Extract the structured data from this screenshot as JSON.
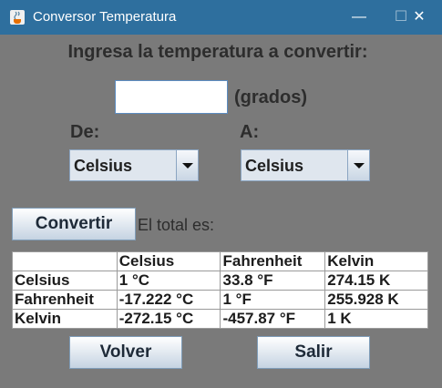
{
  "window": {
    "title": "Conversor Temperatura",
    "icon": "java-coffee-icon",
    "minimize_glyph": "—",
    "maximize_glyph": "☐",
    "close_glyph": "✕",
    "accent": "#2e6f9e",
    "background": "#7a7a7a"
  },
  "form": {
    "heading": "Ingresa la temperatura a convertir:",
    "input_value": "",
    "unit_label": "(grados)",
    "from_label": "De:",
    "to_label": "A:",
    "from_selected": "Celsius",
    "to_selected": "Celsius",
    "convert_label": "Convertir",
    "total_label": "El total es:"
  },
  "results": {
    "headers": [
      "",
      "Celsius",
      "Fahrenheit",
      "Kelvin"
    ],
    "rows": [
      [
        "Celsius",
        "1 °C",
        "33.8 °F",
        "274.15 K"
      ],
      [
        "Fahrenheit",
        "-17.222 °C",
        "1 °F",
        "255.928 K"
      ],
      [
        "Kelvin",
        "-272.15 °C",
        "-457.87 °F",
        "1 K"
      ]
    ]
  },
  "actions": {
    "back_label": "Volver",
    "exit_label": "Salir"
  }
}
